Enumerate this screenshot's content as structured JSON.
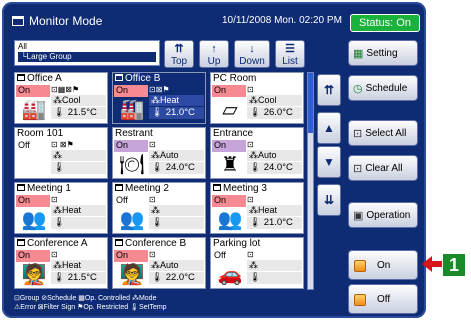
{
  "header": {
    "title": "Monitor Mode",
    "datetime": "10/11/2008 Mon. 02:20 PM",
    "status": "Status: On"
  },
  "group": {
    "line1": "All",
    "line2": "└Large Group"
  },
  "nav": {
    "top": "Top",
    "up": "Up",
    "down": "Down",
    "list": "List"
  },
  "tiles": [
    {
      "name": "Office A",
      "state": "On",
      "mode": "Cool",
      "temp": "21.5°C",
      "icon": "indoor-unit-icon",
      "flags": "⊡▦⊠⚑"
    },
    {
      "name": "Office B",
      "state": "On",
      "mode": "Heat",
      "temp": "21.0°C",
      "icon": "indoor-unit-icon",
      "flags": "⊡⊠⚑"
    },
    {
      "name": "PC Room",
      "state": "On",
      "mode": "Cool",
      "temp": "26.0°C",
      "icon": "ceiling-unit-icon",
      "flags": "⊡"
    },
    {
      "name": "Room 101",
      "state": "Off",
      "mode": "",
      "temp": "",
      "icon": "blank",
      "flags": "⊡ ⊠⚑"
    },
    {
      "name": "Restrant",
      "state": "On",
      "mode": "Auto",
      "temp": "24.0°C",
      "icon": "dining-icon",
      "flags": "⊡"
    },
    {
      "name": "Entrance",
      "state": "On",
      "mode": "Auto",
      "temp": "24.0°C",
      "icon": "lamp-icon",
      "flags": "⊡"
    },
    {
      "name": "Meeting 1",
      "state": "On",
      "mode": "Heat",
      "temp": "",
      "icon": "meeting-icon",
      "flags": "⊡"
    },
    {
      "name": "Meeting 2",
      "state": "Off",
      "mode": "",
      "temp": "",
      "icon": "meeting-icon",
      "flags": "⊡"
    },
    {
      "name": "Meeting 3",
      "state": "On",
      "mode": "Heat",
      "temp": "21.0°C",
      "icon": "meeting-icon",
      "flags": "⊡"
    },
    {
      "name": "Conference A",
      "state": "On",
      "mode": "Heat",
      "temp": "21.5°C",
      "icon": "presentation-icon",
      "flags": "⊡"
    },
    {
      "name": "Conference B",
      "state": "On",
      "mode": "Auto",
      "temp": "22.0°C",
      "icon": "presentation-icon",
      "flags": "⊡"
    },
    {
      "name": "Parking lot",
      "state": "Off",
      "mode": "",
      "temp": "",
      "icon": "car-icon",
      "flags": "⊡"
    }
  ],
  "side": {
    "setting": "Setting",
    "schedule": "Schedule",
    "select_all": "Select All",
    "clear_all": "Clear All",
    "operation": "Operation",
    "on": "On",
    "off": "Off"
  },
  "legend": {
    "line1": "⊡Group ⊘Schedule ▦Op. Controlled ⁂Mode",
    "line2": "⚠Error ⊠Filter Sign ⚑Op. Restricted 🌡SetTemp"
  },
  "callout": {
    "number": "1"
  },
  "colors": {
    "panel": "#0e2b74",
    "status_green": "#19b23a",
    "on_red": "#f58a93",
    "auto_purple": "#c6a3d9",
    "callout_arrow": "#d8141c"
  }
}
